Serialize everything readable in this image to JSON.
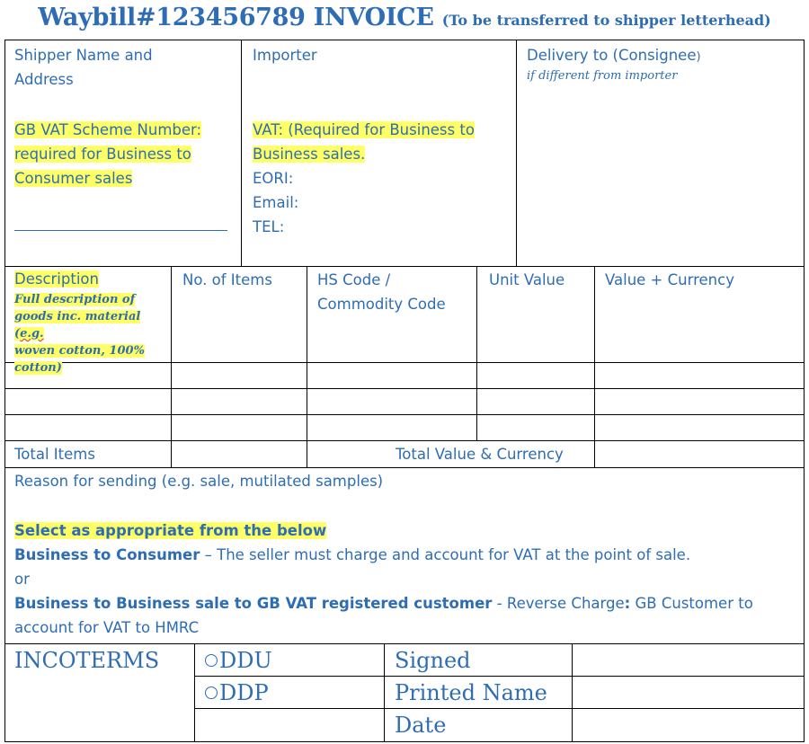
{
  "header": {
    "title": "Waybill#123456789 INVOICE",
    "subtitle": "(To be transferred to shipper letterhead)"
  },
  "parties": {
    "shipper_label_1": "Shipper Name and",
    "shipper_label_2": "Address",
    "gb_vat_1": "GB VAT Scheme Number:",
    "gb_vat_2": "required for Business to",
    "gb_vat_3": "Consumer sales",
    "importer_label": "Importer",
    "vat_1": "VAT: (Required for Business to",
    "vat_2": "Business sales.",
    "eori": "EORI:",
    "email": "Email:",
    "tel": "TEL:",
    "delivery_label": "Delivery to (Consignee",
    "delivery_paren": ")",
    "delivery_note": "if different from importer"
  },
  "items_table": {
    "col_description": "Description",
    "description_note_1": "Full description of",
    "description_note_2a": "goods inc. material (",
    "description_note_2b": "e.g.",
    "description_note_3": "woven cotton, 100%",
    "description_note_4": "cotton)",
    "col_items": "No. of Items",
    "col_hs_1": "HS Code /",
    "col_hs_2": "Commodity Code",
    "col_unit": "Unit Value",
    "col_value": "Value + Currency",
    "total_items": "Total Items",
    "total_value": "Total Value & Currency"
  },
  "reason": {
    "label": "Reason for sending (e.g. sale, mutilated samples)",
    "select_heading": "Select as appropriate from the below",
    "b2c_bold": "Business to Consumer",
    "b2c_text": " – The seller must charge and account for VAT at the point of sale.",
    "or": "or",
    "b2b_bold": "Business to Business sale to GB VAT registered customer",
    "b2b_text_1": " - Reverse Charge",
    "b2b_colon": ":",
    "b2b_text_2": " GB Customer to",
    "b2b_text_3": "account for VAT to HMRC"
  },
  "footer": {
    "incoterms": "INCOTERMS",
    "ddu": "DDU",
    "ddp": "DDP",
    "signed": "Signed",
    "printed_name": "Printed Name",
    "date": "Date"
  }
}
